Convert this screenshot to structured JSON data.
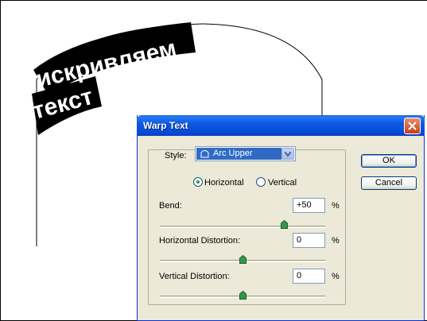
{
  "canvas": {
    "warped_text_line1": "искривляем",
    "warped_text_line2": "текст"
  },
  "dialog": {
    "title": "Warp Text",
    "style_label": "Style:",
    "style_value": "Arc Upper",
    "orientation": {
      "horizontal_label": "Horizontal",
      "vertical_label": "Vertical",
      "selected": "Horizontal"
    },
    "bend": {
      "label": "Bend:",
      "value": "+50",
      "unit": "%",
      "slider_fraction": 0.75
    },
    "horizontal_distortion": {
      "label": "Horizontal Distortion:",
      "value": "0",
      "unit": "%",
      "slider_fraction": 0.5
    },
    "vertical_distortion": {
      "label": "Vertical Distortion:",
      "value": "0",
      "unit": "%",
      "slider_fraction": 0.5
    },
    "ok_label": "OK",
    "cancel_label": "Cancel"
  },
  "colors": {
    "titlebar": "#0a5fdb",
    "dialog_bg": "#ece9d8",
    "selection": "#316ac5",
    "close_button": "#c2411b",
    "radio_dot": "#21a121",
    "slider_thumb": "#2f9a4a"
  },
  "icons": [
    "arc-upper-icon",
    "dropdown-arrow-icon",
    "close-icon",
    "slider-thumb-icon"
  ]
}
